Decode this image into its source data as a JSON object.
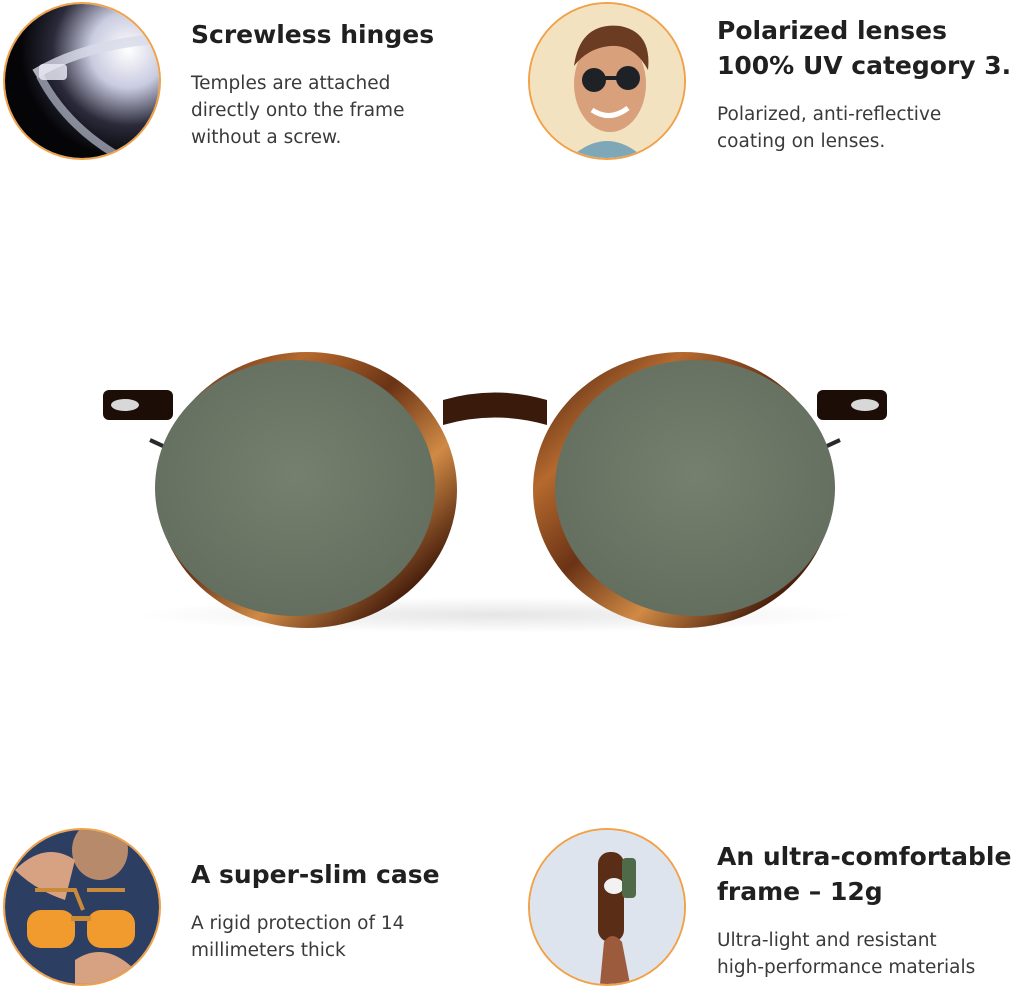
{
  "features": [
    {
      "title_lines": [
        "Screwless hinges"
      ],
      "desc_lines": [
        "Temples are attached",
        "directly onto the frame",
        "without a screw."
      ],
      "image": "transparent-hinge-closeup"
    },
    {
      "title_lines": [
        "Polarized lenses",
        "100% UV category 3."
      ],
      "desc_lines": [
        "Polarized, anti-reflective",
        "coating on lenses."
      ],
      "image": "smiling-man-wearing-sunglasses"
    },
    {
      "title_lines": [
        "A super-slim case"
      ],
      "desc_lines": [
        "A rigid protection of 14",
        "millimeters thick"
      ],
      "image": "hands-holding-orange-glasses"
    },
    {
      "title_lines": [
        "An ultra-comfortable",
        "frame – 12g"
      ],
      "desc_lines": [
        "Ultra-light and resistant",
        "high-performance materials"
      ],
      "image": "hand-holding-slim-case"
    }
  ],
  "product": {
    "image": "tortoiseshell-round-sunglasses-front",
    "frame_color": "#7a3f1c",
    "lens_color": "#6e7a68"
  },
  "colors": {
    "thumb_border": "#f0a24a",
    "title": "#202020",
    "text": "#3a3a3a"
  }
}
